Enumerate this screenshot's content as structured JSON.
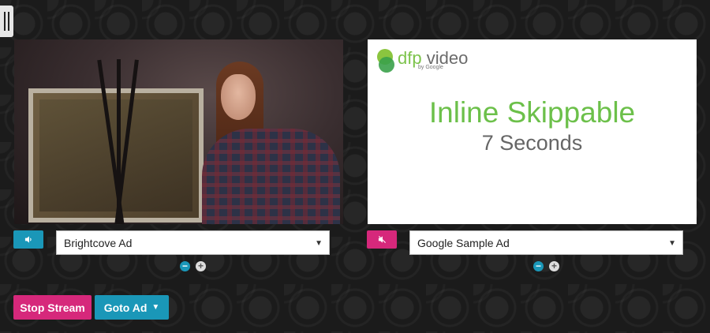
{
  "left_player": {
    "ad_select_value": "Brightcove Ad",
    "mute_icon": "speaker-icon",
    "zoom_minus": "−",
    "zoom_plus": "+"
  },
  "right_player": {
    "logo": {
      "brand": "dfp",
      "word": "video",
      "sub": "by Google"
    },
    "slate_title": "Inline Skippable",
    "slate_subtitle": "7 Seconds",
    "ad_select_value": "Google Sample Ad",
    "mute_icon": "speaker-muted-icon",
    "zoom_minus": "−",
    "zoom_plus": "+"
  },
  "controls": {
    "stop_label": "Stop Stream",
    "goto_label": "Goto Ad",
    "goto_caret": "▼"
  },
  "colors": {
    "teal": "#1a97b8",
    "pink": "#d6287b",
    "dfp_green": "#6cc04a"
  }
}
